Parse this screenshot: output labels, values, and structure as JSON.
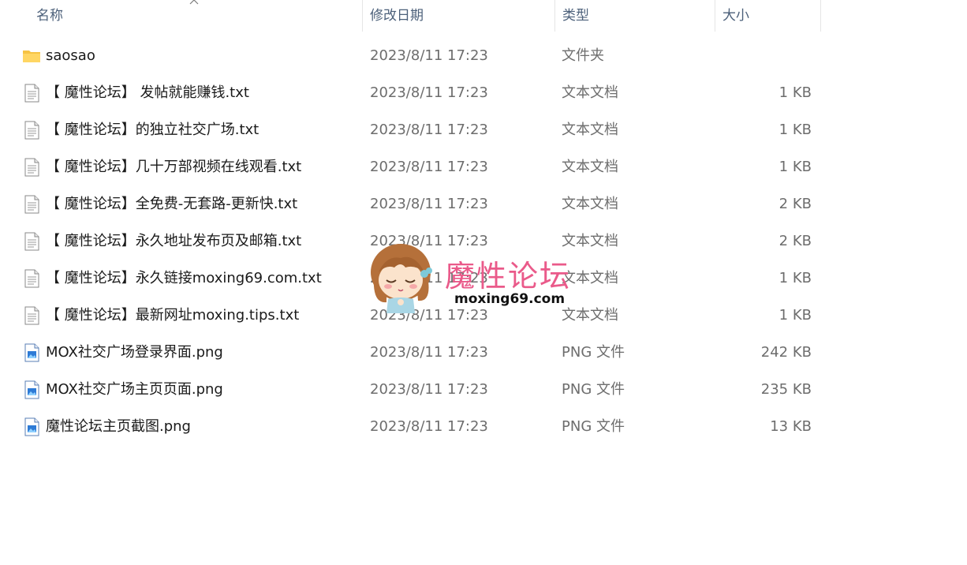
{
  "columns": {
    "name": "名称",
    "date": "修改日期",
    "type": "类型",
    "size": "大小"
  },
  "files": [
    {
      "name": "saosao",
      "date": "2023/8/11 17:23",
      "type": "文件夹",
      "size": "",
      "icon": "folder-icon"
    },
    {
      "name": "【 魔性论坛】 发帖就能赚钱.txt",
      "date": "2023/8/11 17:23",
      "type": "文本文档",
      "size": "1 KB",
      "icon": "text-file-icon"
    },
    {
      "name": "【 魔性论坛】的独立社交广场.txt",
      "date": "2023/8/11 17:23",
      "type": "文本文档",
      "size": "1 KB",
      "icon": "text-file-icon"
    },
    {
      "name": "【 魔性论坛】几十万部视频在线观看.txt",
      "date": "2023/8/11 17:23",
      "type": "文本文档",
      "size": "1 KB",
      "icon": "text-file-icon"
    },
    {
      "name": "【 魔性论坛】全免费-无套路-更新快.txt",
      "date": "2023/8/11 17:23",
      "type": "文本文档",
      "size": "2 KB",
      "icon": "text-file-icon"
    },
    {
      "name": "【 魔性论坛】永久地址发布页及邮箱.txt",
      "date": "2023/8/11 17:23",
      "type": "文本文档",
      "size": "2 KB",
      "icon": "text-file-icon"
    },
    {
      "name": "【 魔性论坛】永久链接moxing69.com.txt",
      "date": "2023/8/11 17:23",
      "type": "文本文档",
      "size": "1 KB",
      "icon": "text-file-icon"
    },
    {
      "name": "【 魔性论坛】最新网址moxing.tips.txt",
      "date": "2023/8/11 17:23",
      "type": "文本文档",
      "size": "1 KB",
      "icon": "text-file-icon"
    },
    {
      "name": "MOX社交广场登录界面.png",
      "date": "2023/8/11 17:23",
      "type": "PNG 文件",
      "size": "242 KB",
      "icon": "image-file-icon"
    },
    {
      "name": "MOX社交广场主页页面.png",
      "date": "2023/8/11 17:23",
      "type": "PNG 文件",
      "size": "235 KB",
      "icon": "image-file-icon"
    },
    {
      "name": "魔性论坛主页截图.png",
      "date": "2023/8/11 17:23",
      "type": "PNG 文件",
      "size": "13 KB",
      "icon": "image-file-icon"
    }
  ],
  "watermark": {
    "title": "魔性论坛",
    "url": "moxing69.com"
  },
  "colors": {
    "header_text": "#4c607a",
    "secondary_text": "#6d6d6d",
    "folder": "#f6c344",
    "watermark_pink": "#ea5a8a"
  }
}
